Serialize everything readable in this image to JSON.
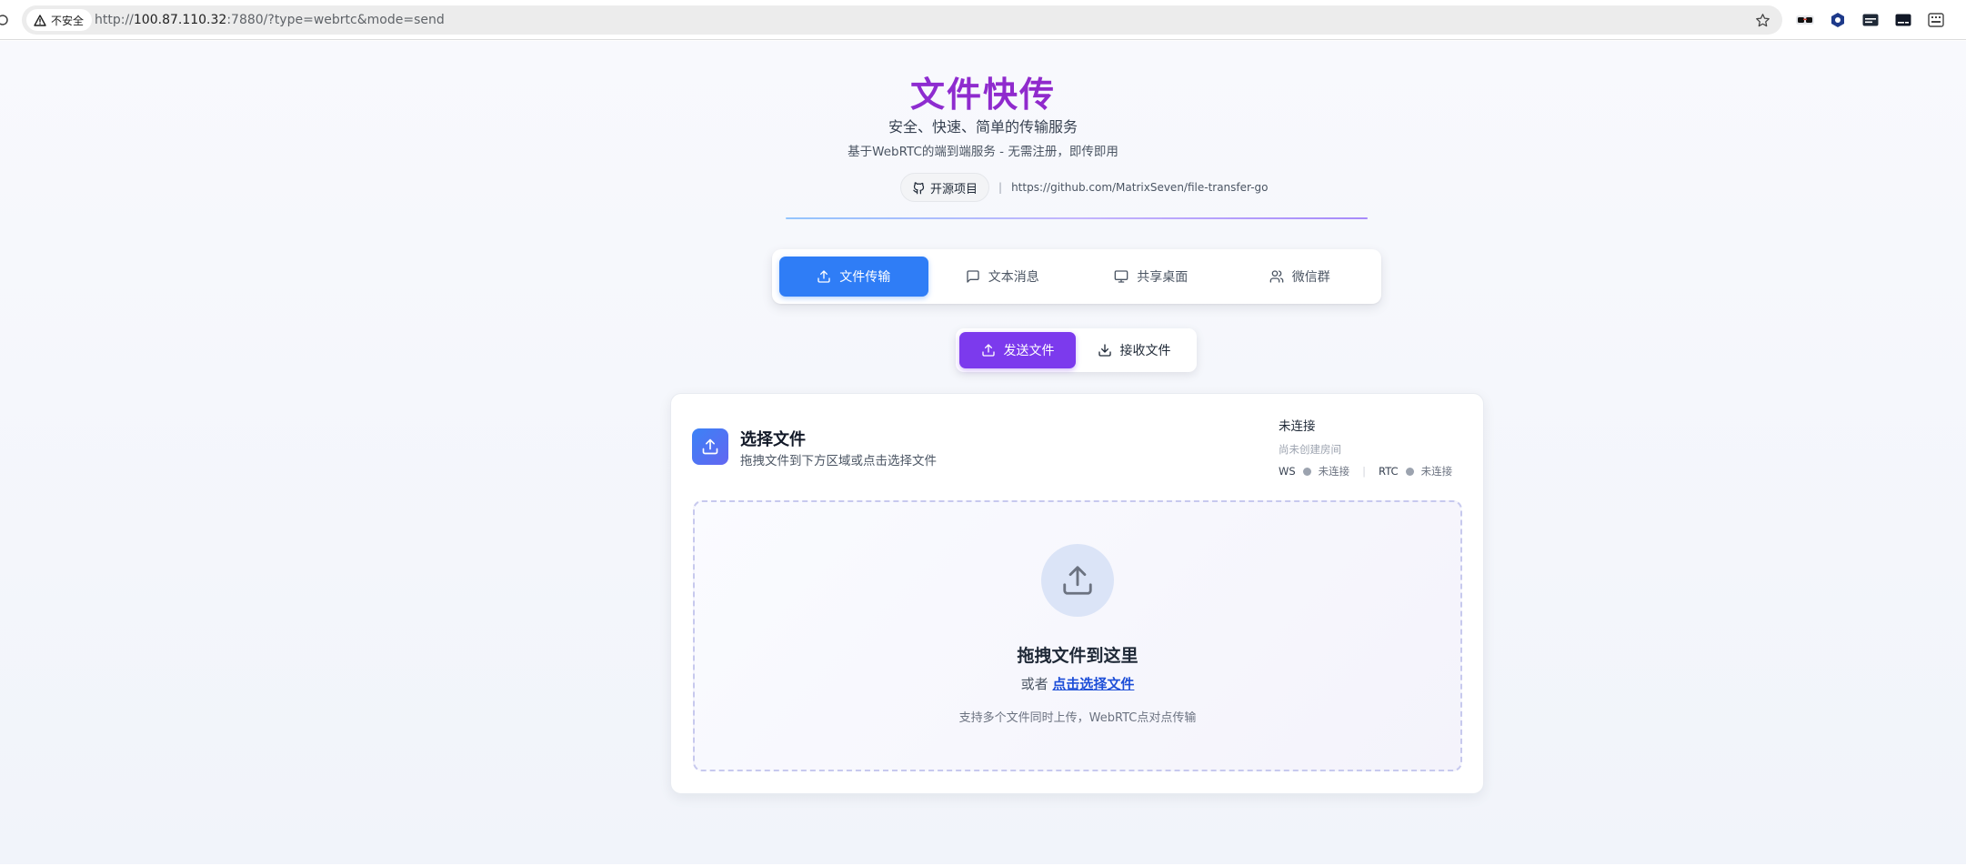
{
  "browser": {
    "security_label": "不安全",
    "url_scheme": "http://",
    "url_host": "100.87.110.32",
    "url_rest": ":7880/?type=webrtc&mode=send"
  },
  "header": {
    "title": "文件快传",
    "subtitle": "安全、快速、简单的传输服务",
    "description": "基于WebRTC的端到端服务 - 无需注册，即传即用",
    "repo_button_label": "开源项目",
    "repo_separator": "|",
    "repo_url": "https://github.com/MatrixSeven/file-transfer-go"
  },
  "main_tabs": [
    {
      "label": "文件传输",
      "icon": "upload-icon",
      "active": true
    },
    {
      "label": "文本消息",
      "icon": "message-icon",
      "active": false
    },
    {
      "label": "共享桌面",
      "icon": "monitor-icon",
      "active": false
    },
    {
      "label": "微信群",
      "icon": "users-icon",
      "active": false
    }
  ],
  "mode_toggle": [
    {
      "label": "发送文件",
      "icon": "upload-icon",
      "active": true
    },
    {
      "label": "接收文件",
      "icon": "download-icon",
      "active": false
    }
  ],
  "upload_card": {
    "title": "选择文件",
    "description": "拖拽文件到下方区域或点击选择文件",
    "status": {
      "title": "未连接",
      "room": "尚未创建房间",
      "ws_label": "WS",
      "ws_state": "未连接",
      "separator": "|",
      "rtc_label": "RTC",
      "rtc_state": "未连接"
    },
    "dropzone": {
      "title": "拖拽文件到这里",
      "or_text": "或者",
      "select_link": "点击选择文件",
      "hint": "支持多个文件同时上传，WebRTC点对点传输"
    }
  },
  "colors": {
    "primary_blue": "#2f7df6",
    "accent_purple": "#7c3aed",
    "status_gray": "#9ca3af"
  }
}
